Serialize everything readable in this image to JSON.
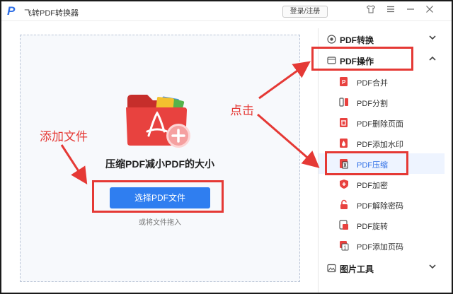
{
  "window": {
    "logo": "P",
    "title": "飞转PDF转换器"
  },
  "titlebar": {
    "login_label": "登录/注册"
  },
  "workarea": {
    "drop_title": "压缩PDF减小PDF的大小",
    "select_button": "选择PDF文件",
    "drag_hint": "或将文件拖入"
  },
  "sidebar": {
    "categories": [
      {
        "label": "PDF转换",
        "state": "collapsed"
      },
      {
        "label": "PDF操作",
        "state": "expanded"
      },
      {
        "label": "图片工具",
        "state": "collapsed"
      }
    ],
    "items": [
      {
        "label": "PDF合并",
        "icon": "merge-icon"
      },
      {
        "label": "PDF分割",
        "icon": "split-icon"
      },
      {
        "label": "PDF删除页面",
        "icon": "delete-page-icon"
      },
      {
        "label": "PDF添加水印",
        "icon": "watermark-icon"
      },
      {
        "label": "PDF压缩",
        "icon": "compress-icon",
        "active": true
      },
      {
        "label": "PDF加密",
        "icon": "encrypt-icon"
      },
      {
        "label": "PDF解除密码",
        "icon": "unlock-icon"
      },
      {
        "label": "PDF旋转",
        "icon": "rotate-icon"
      },
      {
        "label": "PDF添加页码",
        "icon": "page-number-icon"
      }
    ]
  },
  "annotations": {
    "add_file": "添加文件",
    "click": "点击"
  },
  "colors": {
    "accent": "#2f7ef0",
    "annotation": "#e53935",
    "icon_red": "#e8423f"
  }
}
